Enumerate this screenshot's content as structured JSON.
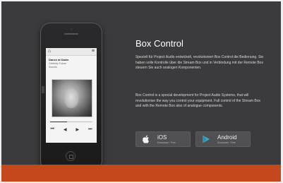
{
  "hero": {
    "title": "Box Control",
    "paragraph_1": "Speziell für Project Audio entwickelt, revolutioniert Box Control die Bedienung. Sie haben volle Kontrolle über die Stream Box und in Verbindung mit der Remote Box steuern Sie auch analogen Komponenten.",
    "paragraph_2": "Box Control is a special development for Project Audio Systems, that will revolutionise the way you control your equipment. Full control of the Stream Box and with the Remote Box also of analogue components."
  },
  "phone_app": {
    "track_title": "Dance at Dawn",
    "track_artist": "Celebrity Future Sounds",
    "progress_fraction": 0.4,
    "controls": [
      "⏮",
      "◀",
      "▶",
      "⏭"
    ]
  },
  "stores": {
    "ios": {
      "name": "iOS",
      "sub": "Download · Free"
    },
    "android": {
      "name": "Android",
      "sub": "Download · Free"
    }
  },
  "colors": {
    "background": "#3b3b3d",
    "accent_bar": "#c4481c",
    "android_logo": "#3fb0c9"
  }
}
